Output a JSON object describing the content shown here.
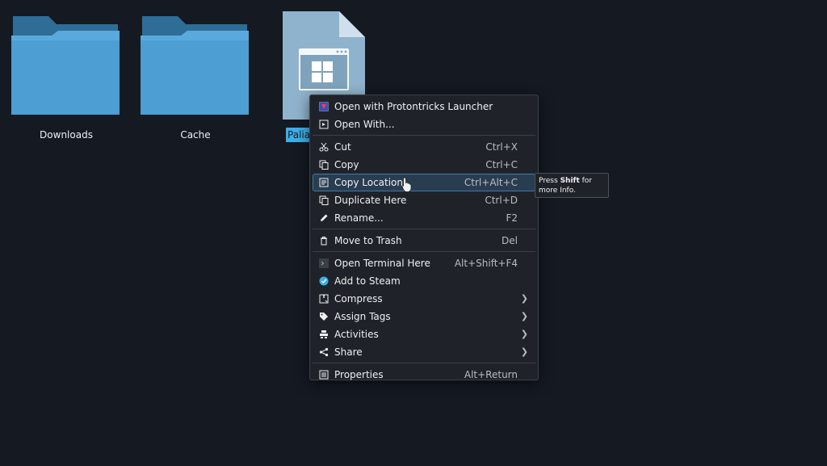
{
  "desktop": {
    "icons": [
      {
        "label": "Downloads"
      },
      {
        "label": "Cache"
      },
      {
        "label": "Paliat"
      }
    ]
  },
  "menu": {
    "items": [
      {
        "label": "Open with Protontricks Launcher",
        "shortcut": "",
        "icon": "protontricks-icon"
      },
      {
        "label": "Open With...",
        "shortcut": "",
        "icon": "open-with-icon"
      },
      {
        "label": "Cut",
        "shortcut": "Ctrl+X",
        "icon": "scissors-icon"
      },
      {
        "label": "Copy",
        "shortcut": "Ctrl+C",
        "icon": "copy-icon"
      },
      {
        "label": "Copy Location",
        "shortcut": "Ctrl+Alt+C",
        "icon": "copy-location-icon"
      },
      {
        "label": "Duplicate Here",
        "shortcut": "Ctrl+D",
        "icon": "duplicate-icon"
      },
      {
        "label": "Rename...",
        "shortcut": "F2",
        "icon": "pencil-icon"
      },
      {
        "label": "Move to Trash",
        "shortcut": "Del",
        "icon": "trash-icon"
      },
      {
        "label": "Open Terminal Here",
        "shortcut": "Alt+Shift+F4",
        "icon": "terminal-icon"
      },
      {
        "label": "Add to Steam",
        "shortcut": "",
        "icon": "steam-check-icon"
      },
      {
        "label": "Compress",
        "shortcut": "",
        "icon": "compress-icon"
      },
      {
        "label": "Assign Tags",
        "shortcut": "",
        "icon": "tag-icon"
      },
      {
        "label": "Activities",
        "shortcut": "",
        "icon": "activities-icon"
      },
      {
        "label": "Share",
        "shortcut": "",
        "icon": "share-icon"
      },
      {
        "label": "Properties",
        "shortcut": "Alt+Return",
        "icon": "properties-icon"
      }
    ],
    "hovered": "Copy Location"
  },
  "tooltip": {
    "prefix": "Press ",
    "key": "Shift",
    "suffix": " for more Info."
  },
  "colors": {
    "background": "#141922",
    "accent": "#3daee9",
    "menu_bg": "#1f2329",
    "hover_bg": "#293d50"
  }
}
